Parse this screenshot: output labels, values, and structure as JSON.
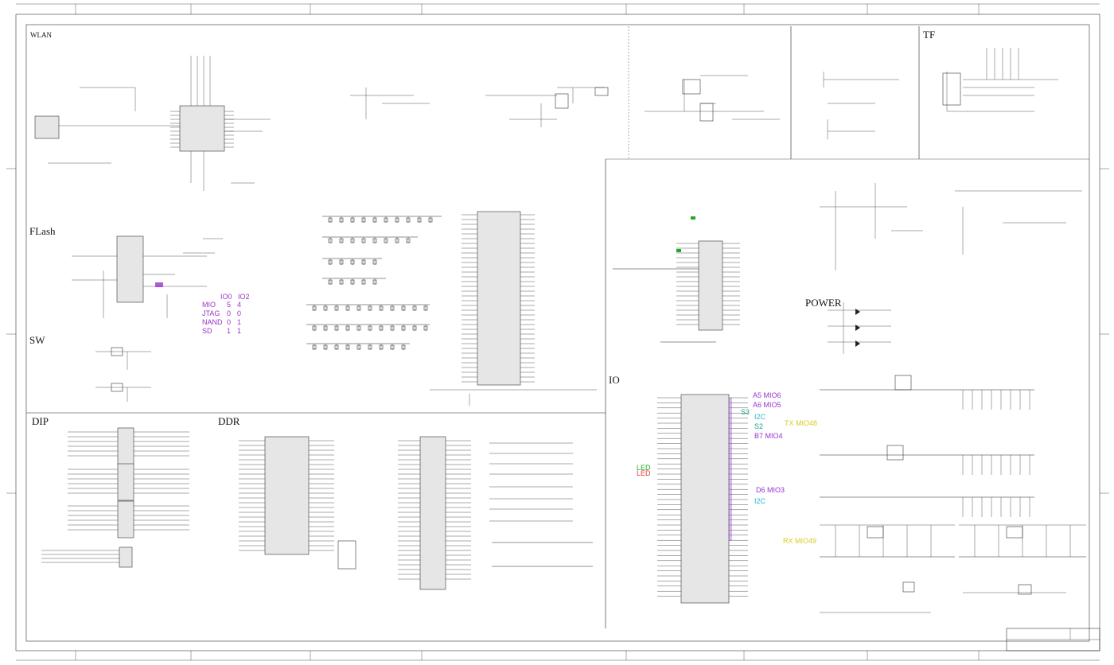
{
  "sections": {
    "wlan": "WLAN",
    "flash": "FLash",
    "sw": "SW",
    "dip": "DIP",
    "ddr": "DDR",
    "tf": "TF",
    "power": "POWER",
    "io": "IO"
  },
  "boot_table": {
    "header": [
      "IO0",
      "IO2"
    ],
    "rows": [
      {
        "name": "MIO",
        "io0": "5",
        "io2": "4"
      },
      {
        "name": "JTAG",
        "io0": "0",
        "io2": "0"
      },
      {
        "name": "NAND",
        "io0": "0",
        "io2": "1"
      },
      {
        "name": "SD",
        "io0": "1",
        "io2": "1"
      }
    ]
  },
  "io_labels": {
    "a5": "A5 MIO6",
    "a6": "A6 MIO5",
    "s3": "S3",
    "i2c_1": "I2C",
    "s2": "S2",
    "tx_mio": "TX MIO48",
    "b7": "B7 MIO4",
    "led_1": "LED",
    "led_2": "LED",
    "d6": "D6 MIO3",
    "i2c_2": "I2C",
    "rx_mio": "RX MIO49"
  },
  "colors": {
    "purple": "#9933cc",
    "teal": "#1aa58a",
    "green": "#22aa22",
    "red": "#dd3333",
    "cyan": "#22bbcc",
    "yellow": "#d8cc22"
  }
}
